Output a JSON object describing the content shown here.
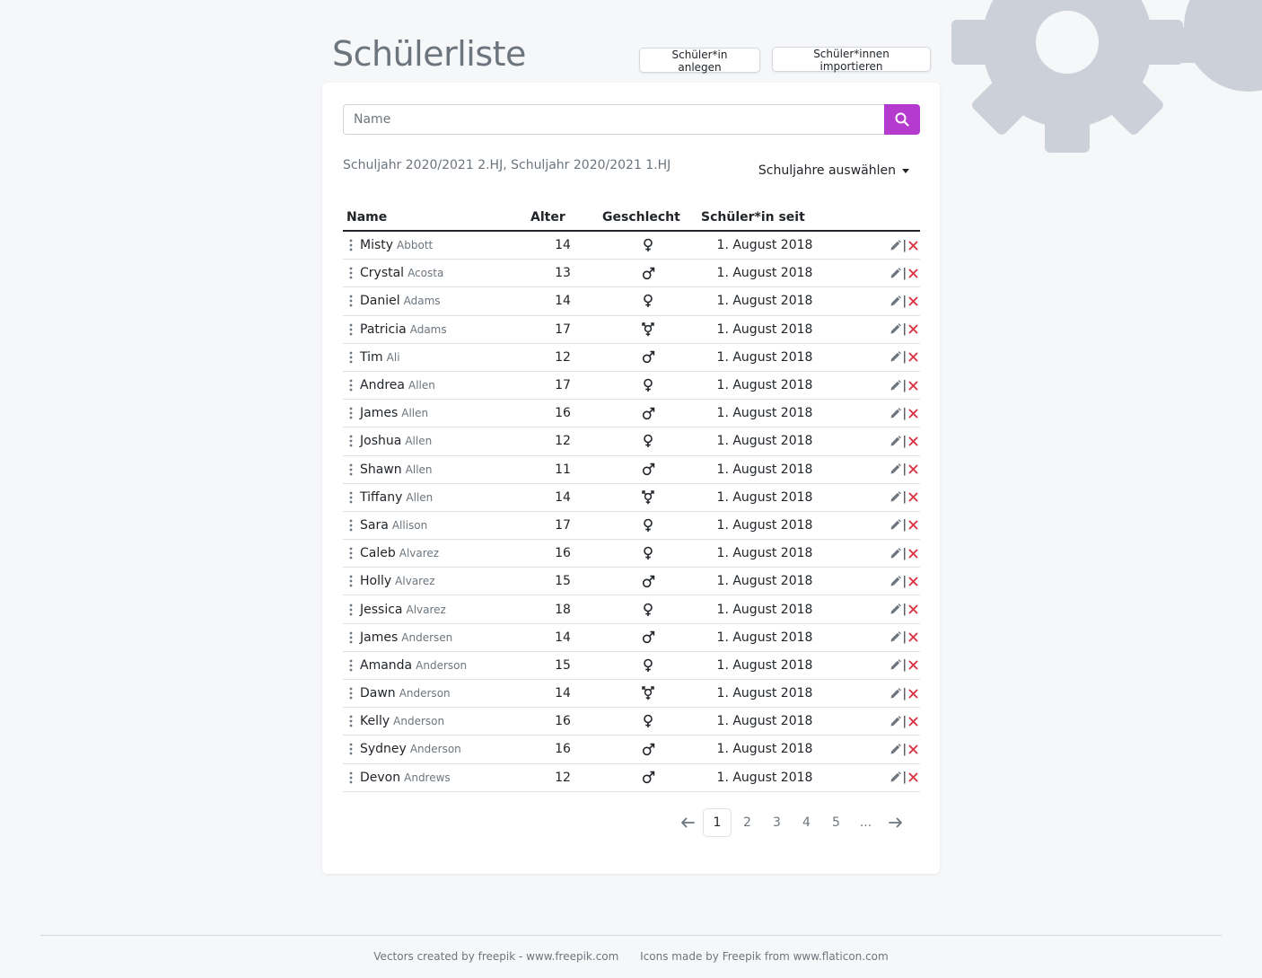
{
  "page": {
    "title": "Schülerliste"
  },
  "toolbar": {
    "add_label": "Schüler*in anlegen",
    "import_label": "Schüler*innen importieren"
  },
  "search": {
    "placeholder": "Name",
    "value": "",
    "button_icon": "search-icon"
  },
  "filters": {
    "selected_years": "Schuljahr 2020/2021 2.HJ, Schuljahr 2020/2021 1.HJ",
    "dropdown_label": "Schuljahre auswählen"
  },
  "table": {
    "headers": {
      "name": "Name",
      "age": "Alter",
      "gender": "Geschlecht",
      "since": "Schüler*in seit"
    },
    "rows": [
      {
        "first": "Misty",
        "last": "Abbott",
        "age": "14",
        "gender": "female",
        "since": "1. August 2018"
      },
      {
        "first": "Crystal",
        "last": "Acosta",
        "age": "13",
        "gender": "male",
        "since": "1. August 2018"
      },
      {
        "first": "Daniel",
        "last": "Adams",
        "age": "14",
        "gender": "female",
        "since": "1. August 2018"
      },
      {
        "first": "Patricia",
        "last": "Adams",
        "age": "17",
        "gender": "diverse",
        "since": "1. August 2018"
      },
      {
        "first": "Tim",
        "last": "Ali",
        "age": "12",
        "gender": "male",
        "since": "1. August 2018"
      },
      {
        "first": "Andrea",
        "last": "Allen",
        "age": "17",
        "gender": "female",
        "since": "1. August 2018"
      },
      {
        "first": "James",
        "last": "Allen",
        "age": "16",
        "gender": "male",
        "since": "1. August 2018"
      },
      {
        "first": "Joshua",
        "last": "Allen",
        "age": "12",
        "gender": "female",
        "since": "1. August 2018"
      },
      {
        "first": "Shawn",
        "last": "Allen",
        "age": "11",
        "gender": "male",
        "since": "1. August 2018"
      },
      {
        "first": "Tiffany",
        "last": "Allen",
        "age": "14",
        "gender": "diverse",
        "since": "1. August 2018"
      },
      {
        "first": "Sara",
        "last": "Allison",
        "age": "17",
        "gender": "female",
        "since": "1. August 2018"
      },
      {
        "first": "Caleb",
        "last": "Alvarez",
        "age": "16",
        "gender": "female",
        "since": "1. August 2018"
      },
      {
        "first": "Holly",
        "last": "Alvarez",
        "age": "15",
        "gender": "male",
        "since": "1. August 2018"
      },
      {
        "first": "Jessica",
        "last": "Alvarez",
        "age": "18",
        "gender": "female",
        "since": "1. August 2018"
      },
      {
        "first": "James",
        "last": "Andersen",
        "age": "14",
        "gender": "male",
        "since": "1. August 2018"
      },
      {
        "first": "Amanda",
        "last": "Anderson",
        "age": "15",
        "gender": "female",
        "since": "1. August 2018"
      },
      {
        "first": "Dawn",
        "last": "Anderson",
        "age": "14",
        "gender": "diverse",
        "since": "1. August 2018"
      },
      {
        "first": "Kelly",
        "last": "Anderson",
        "age": "16",
        "gender": "female",
        "since": "1. August 2018"
      },
      {
        "first": "Sydney",
        "last": "Anderson",
        "age": "16",
        "gender": "male",
        "since": "1. August 2018"
      },
      {
        "first": "Devon",
        "last": "Andrews",
        "age": "12",
        "gender": "male",
        "since": "1. August 2018"
      }
    ],
    "action_separator": "|"
  },
  "pagination": {
    "prev_icon": "arrow-left-icon",
    "pages": [
      "1",
      "2",
      "3",
      "4",
      "5",
      "..."
    ],
    "active": "1",
    "next_icon": "arrow-right-icon"
  },
  "footer": {
    "credit_vectors": "Vectors created by freepik - www.freepik.com",
    "credit_icons": "Icons made by Freepik from www.flaticon.com"
  },
  "colors": {
    "accent": "#b53bcf",
    "delete": "#dc3545",
    "edit": "#6c757d",
    "muted": "#6c757d",
    "gear": "#ccd1d9"
  }
}
